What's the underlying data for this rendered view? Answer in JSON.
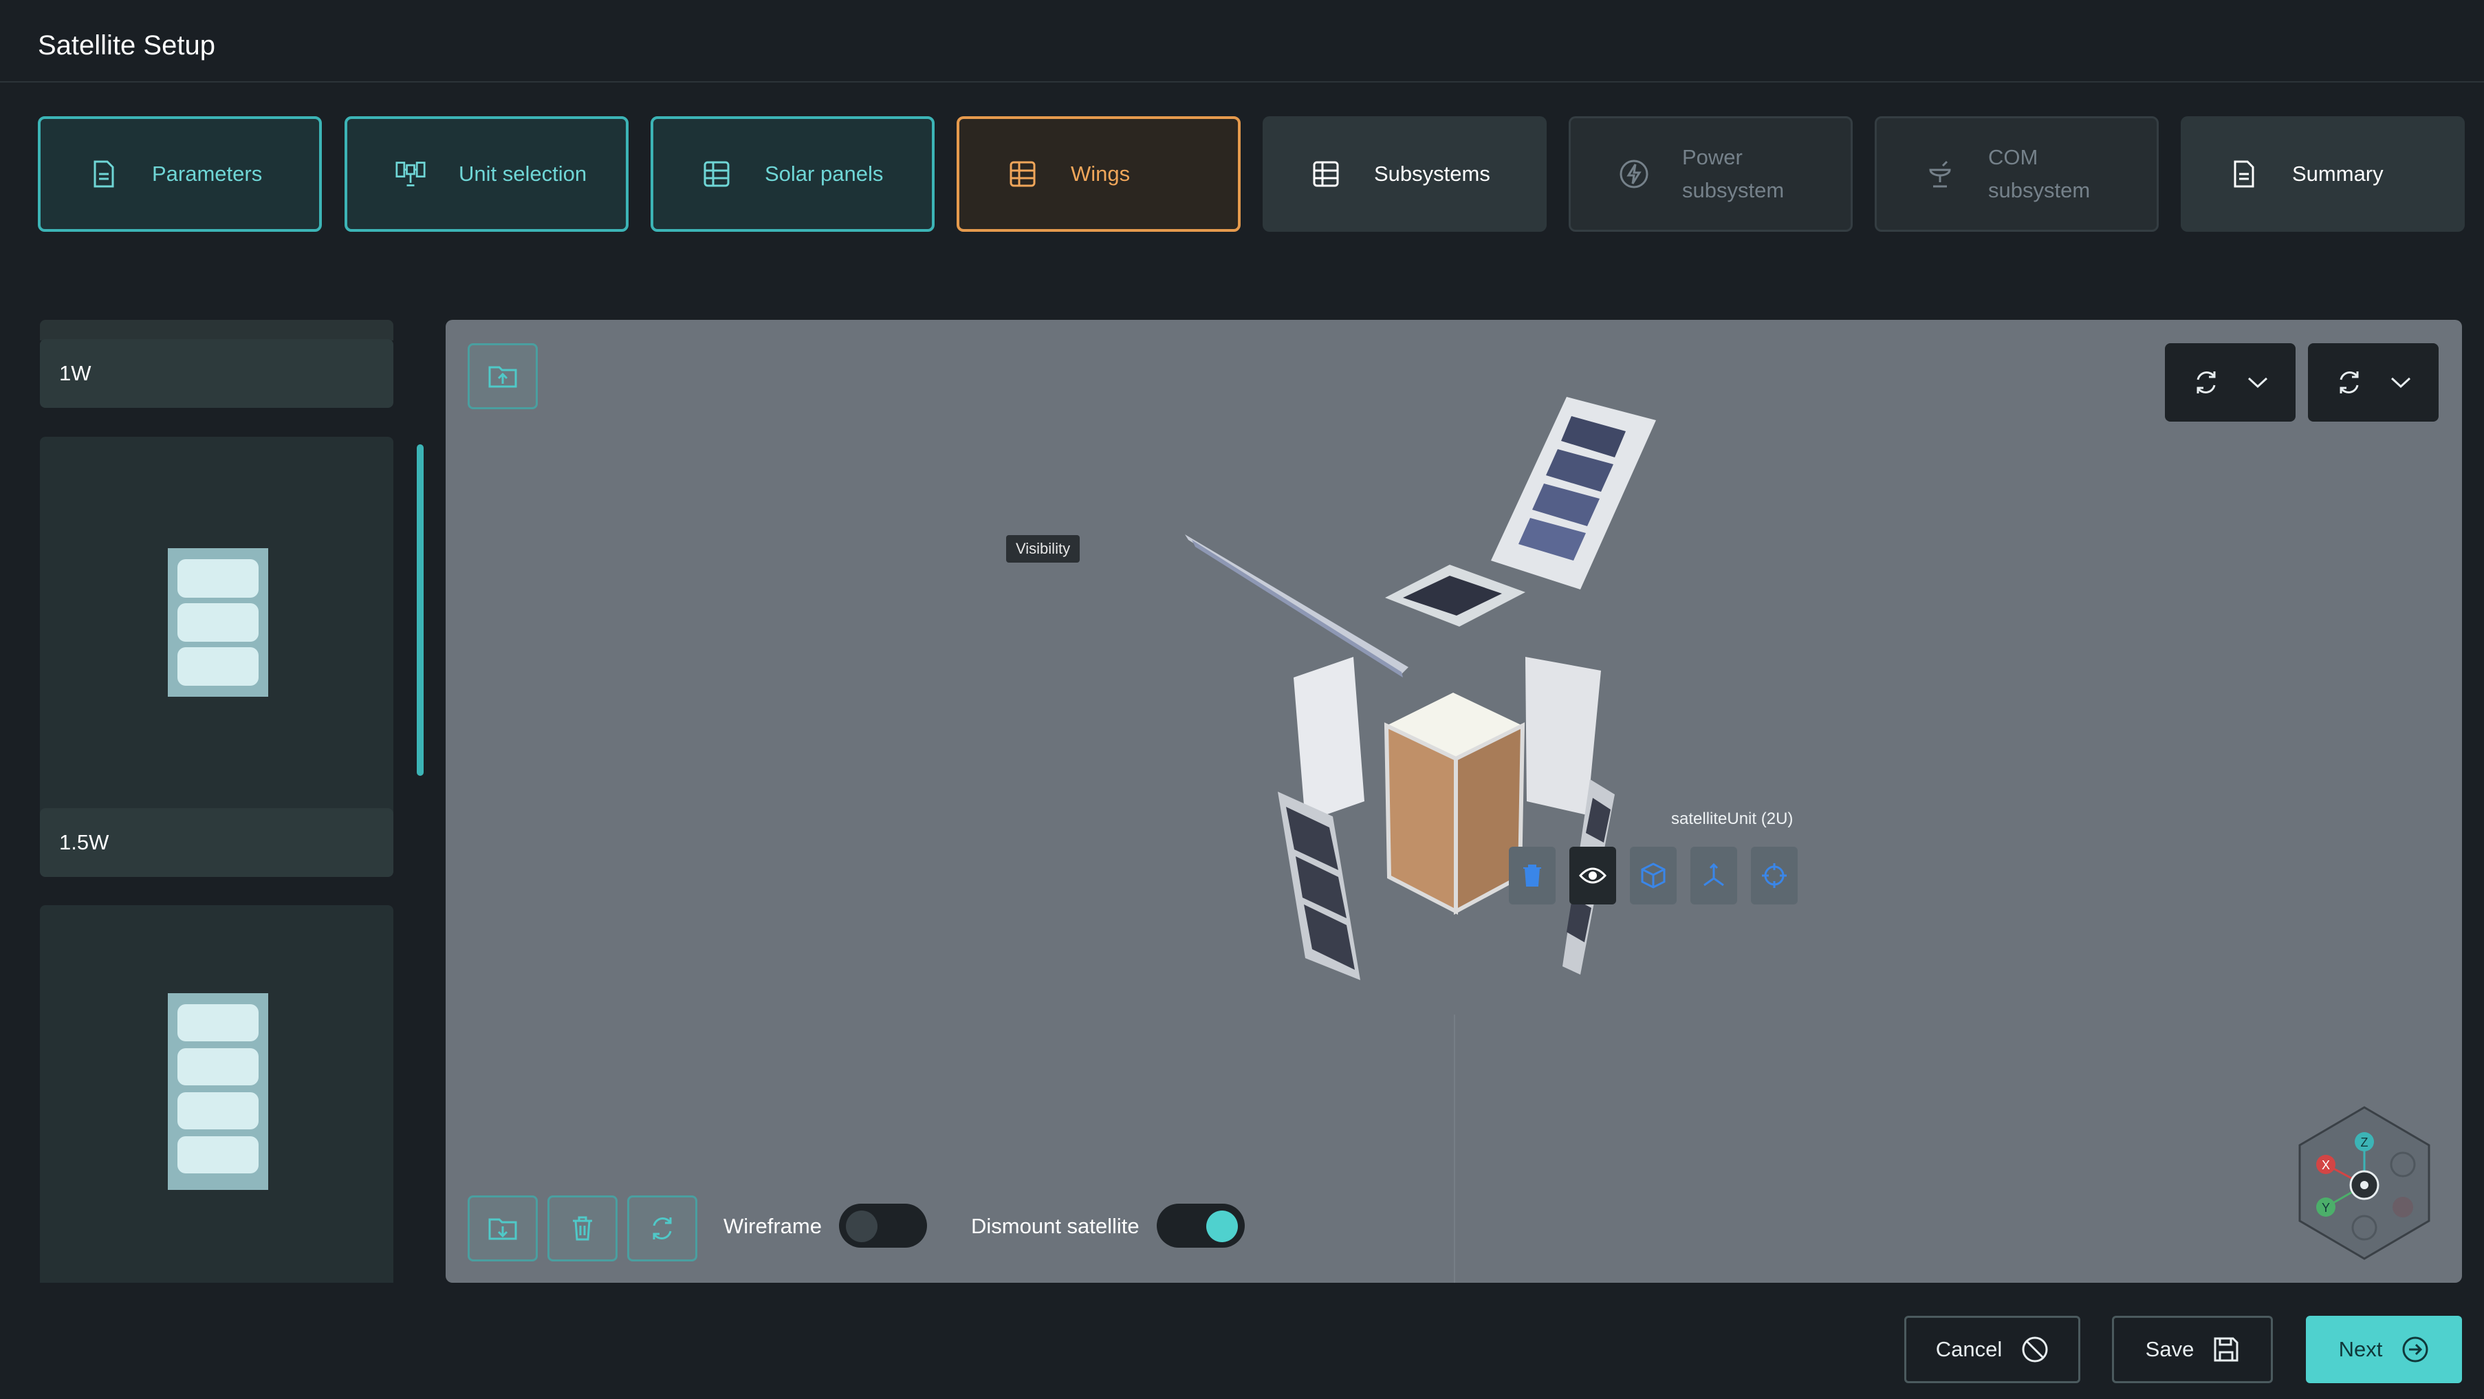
{
  "app": {
    "title": "Satellite Setup"
  },
  "steps": [
    {
      "label": "Parameters",
      "icon": "document-icon",
      "state": "done"
    },
    {
      "label": "Unit selection",
      "icon": "satellite-icon",
      "state": "done"
    },
    {
      "label": "Solar panels",
      "icon": "table-icon",
      "state": "done"
    },
    {
      "label": "Wings",
      "icon": "table-icon",
      "state": "active"
    },
    {
      "label": "Subsystems",
      "icon": "table-icon",
      "state": "next"
    },
    {
      "label_line1": "Power",
      "label_line2": "subsystem",
      "icon": "bolt-icon",
      "state": "disabled"
    },
    {
      "label_line1": "COM",
      "label_line2": "subsystem",
      "icon": "antenna-icon",
      "state": "disabled"
    },
    {
      "label": "Summary",
      "icon": "document-icon",
      "state": "summary"
    }
  ],
  "sidebar": {
    "items": [
      {
        "label": "1W"
      },
      {
        "label": "1.5W"
      },
      {
        "label": ""
      }
    ]
  },
  "viewport": {
    "tooltip": "Visibility",
    "selected_unit": "satelliteUnit (2U)",
    "wireframe_label": "Wireframe",
    "wireframe_on": false,
    "dismount_label": "Dismount satellite",
    "dismount_on": true,
    "gizmo_axes": [
      "Z",
      "X",
      "Y"
    ]
  },
  "footer": {
    "cancel_label": "Cancel",
    "save_label": "Save",
    "next_label": "Next"
  },
  "colors": {
    "accent": "#4fd1ce",
    "active_step": "#e59a4d",
    "background": "#1a1f24",
    "viewport": "#6c737b"
  }
}
